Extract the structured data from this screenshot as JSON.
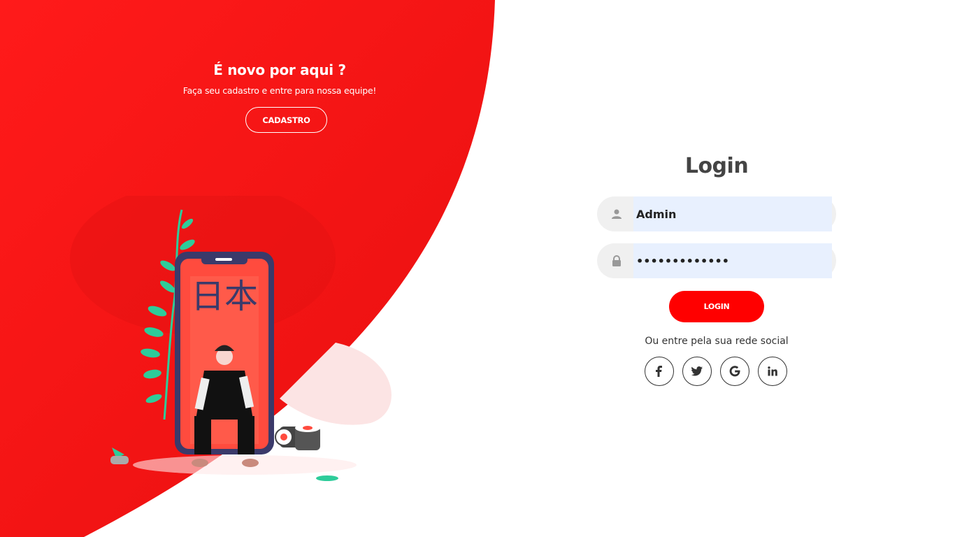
{
  "promo": {
    "title": "É novo por aqui ?",
    "subtitle": "Faça seu cadastro e entre para nossa equipe!",
    "signup_label": "CADASTRO"
  },
  "login": {
    "title": "Login",
    "username_value": "Admin",
    "password_value": "•••••••••••••",
    "login_label": "LOGIN",
    "social_text": "Ou entre pela sua rede social",
    "socials": [
      "facebook-icon",
      "twitter-icon",
      "google-icon",
      "linkedin-icon"
    ]
  },
  "illustration": {
    "kanji": "日本"
  },
  "colors": {
    "accent": "#ff0000",
    "accent_dark": "#e51414",
    "input_bg": "#e8f0fe",
    "field_bg": "#f0f0f0"
  }
}
